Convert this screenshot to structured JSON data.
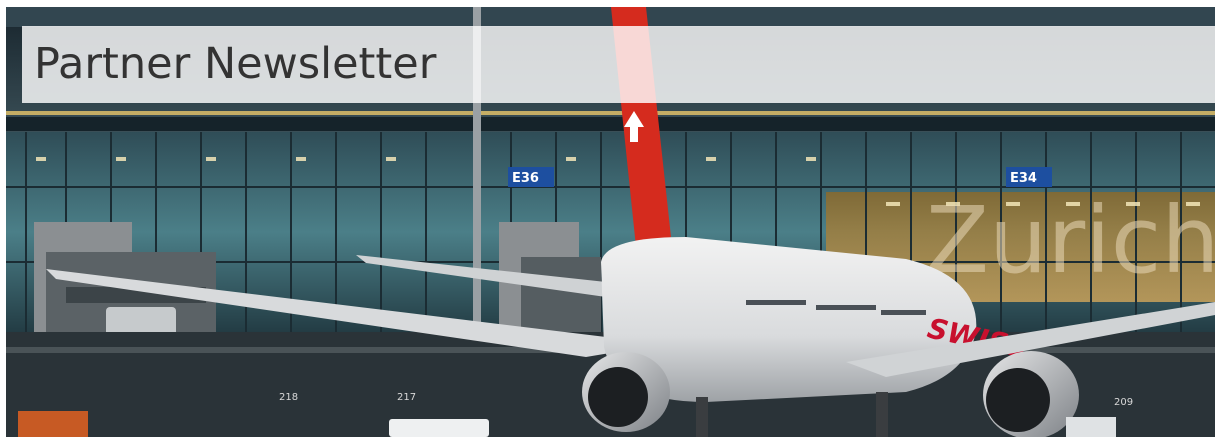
{
  "banner": {
    "title": "Partner Newsletter",
    "background_alt": "Swiss aircraft parked at Zurich airport terminal gates"
  },
  "scene": {
    "gate_signs": [
      {
        "code": "E36"
      },
      {
        "code": "E34"
      }
    ],
    "terminal_lettering": "Zurich",
    "aircraft_livery": "SWISS",
    "stand_numbers": [
      "218",
      "217",
      "209"
    ]
  },
  "colors": {
    "title_text": "#333333",
    "title_band": "#ffffff",
    "gate_sign": "#1d4fa0",
    "tail_red": "#d52b1e",
    "glass": "#3e6e7a",
    "warm_light": "#c9a24a"
  }
}
